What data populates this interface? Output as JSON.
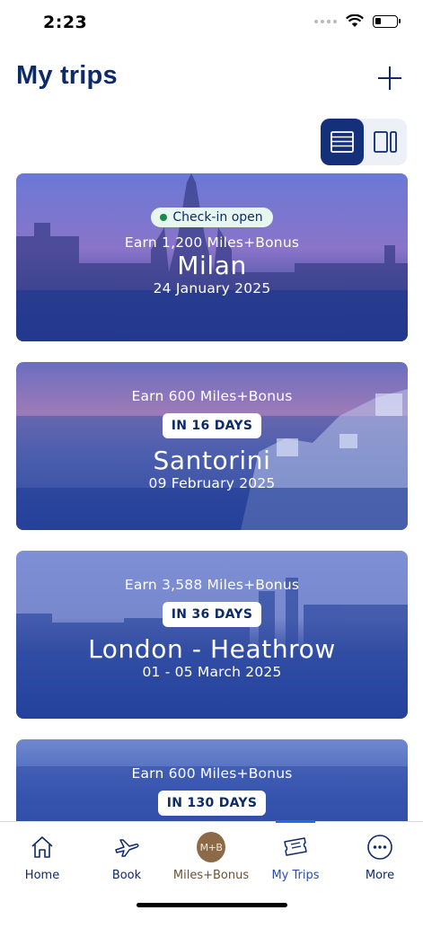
{
  "status_bar": {
    "time": "2:23"
  },
  "header": {
    "title": "My trips"
  },
  "trips": [
    {
      "checkin": "Check-in open",
      "earn": "Earn 1,200 Miles+Bonus",
      "days": "",
      "city": "Milan",
      "date": "24 January 2025"
    },
    {
      "checkin": "",
      "earn": "Earn 600 Miles+Bonus",
      "days": "IN 16 DAYS",
      "city": "Santorini",
      "date": "09 February 2025"
    },
    {
      "checkin": "",
      "earn": "Earn 3,588 Miles+Bonus",
      "days": "IN 36 DAYS",
      "city": "London - Heathrow",
      "date": "01 - 05 March 2025"
    },
    {
      "checkin": "",
      "earn": "Earn 600 Miles+Bonus",
      "days": "IN 130 DAYS",
      "city": "",
      "date": ""
    }
  ],
  "bottom_nav": {
    "items": [
      {
        "label": "Home",
        "icon": "home-icon"
      },
      {
        "label": "Book",
        "icon": "plane-icon"
      },
      {
        "label": "Miles+Bonus",
        "icon": "miles-bonus-icon",
        "coin_text": "M+B"
      },
      {
        "label": "My Trips",
        "icon": "ticket-icon",
        "active": true
      },
      {
        "label": "More",
        "icon": "more-icon"
      }
    ]
  },
  "colors": {
    "primary": "#0d2a6b",
    "active_toggle": "#14307a",
    "checkin_dot": "#1a8a4a",
    "active_nav": "#2a6ae0",
    "miles_coin": "#8c6a47"
  }
}
